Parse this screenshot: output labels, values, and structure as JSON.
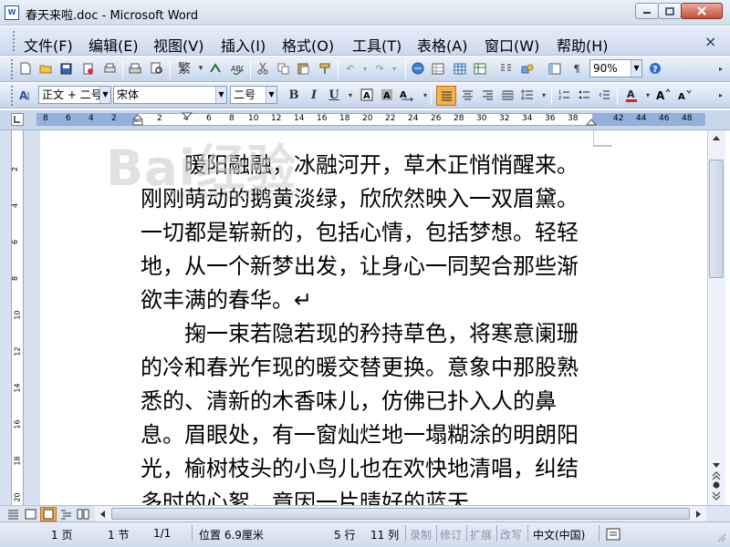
{
  "window": {
    "title": "春天来啦.doc - Microsoft Word",
    "app_icon_text": "W"
  },
  "menubar": {
    "items": [
      "文件(F)",
      "编辑(E)",
      "视图(V)",
      "插入(I)",
      "格式(O)",
      "工具(T)",
      "表格(A)",
      "窗口(W)",
      "帮助(H)"
    ],
    "doc_close": "×"
  },
  "toolbar_standard": {
    "zoom": "90%",
    "traditional_chinese": "繁"
  },
  "toolbar_formatting": {
    "style": "正文 + 二号",
    "font": "宋体",
    "size": "二号",
    "bold": "B",
    "italic": "I",
    "underline": "U"
  },
  "ruler": {
    "numbers": [
      "8",
      "6",
      "4",
      "2",
      "2",
      "4",
      "6",
      "8",
      "10",
      "12",
      "14",
      "16",
      "18",
      "20",
      "22",
      "24",
      "26",
      "28",
      "30",
      "32",
      "34",
      "36",
      "38",
      "42",
      "44",
      "46",
      "48"
    ]
  },
  "vruler": {
    "numbers": [
      "2",
      "4",
      "6",
      "8",
      "10",
      "12",
      "14",
      "16",
      "18",
      "20"
    ]
  },
  "document": {
    "paragraph1": "　　暖阳融融，冰融河开，草木正悄悄醒来。刚刚萌动的鹅黄淡绿，欣欣然映入一双眉黛。一切都是崭新的，包括心情，包括梦想。轻轻地，从一个新梦出发，让身心一同契合那些渐欲丰满的春华。↵",
    "paragraph2": "　　掬一束若隐若现的矜持草色，将寒意阑珊的冷和春光乍现的暖交替更换。意象中那股熟悉的、清新的木香味儿，仿佛已扑入人的鼻息。眉眼处，有一窗灿烂地一塌糊涂的明朗阳光，榆树枝头的小鸟儿也在欢快地清唱，纠结多时的心絮，竟因一片晴好的蓝天"
  },
  "watermark": {
    "logo": "Bai经验",
    "sub": "jingyan.baidu.com"
  },
  "statusbar": {
    "page": "1 页",
    "section": "1 节",
    "page_of": "1/1",
    "position": "位置 6.9厘米",
    "line": "5 行",
    "column": "11 列",
    "rec": "录制",
    "trk": "修订",
    "ext": "扩展",
    "ovr": "改写",
    "language": "中文(中国)"
  },
  "colors": {
    "font_color_bar": "#e02020",
    "highlight_active": "#f6b04a"
  }
}
